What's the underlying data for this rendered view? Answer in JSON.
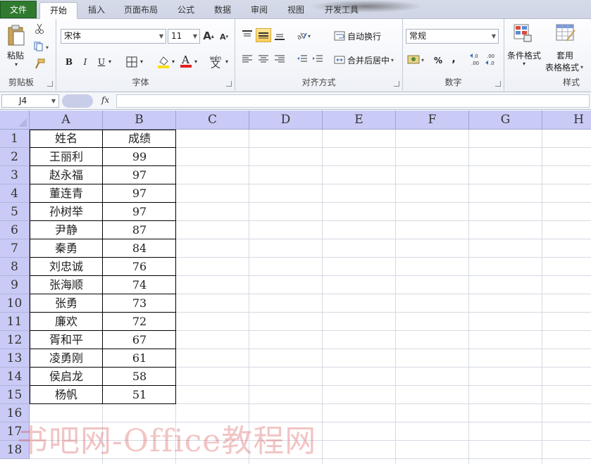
{
  "ribbon_tabs": {
    "file": "文件",
    "home": "开始",
    "insert": "插入",
    "page_layout": "页面布局",
    "formulas": "公式",
    "data": "数据",
    "review": "审阅",
    "view": "视图",
    "developer": "开发工具"
  },
  "clipboard": {
    "paste": "粘贴",
    "label": "剪贴板"
  },
  "font": {
    "name": "宋体",
    "size": "11",
    "bold": "B",
    "italic": "I",
    "underline": "U",
    "phonetic": "wén",
    "label": "字体",
    "fill_color": "#f7e01b",
    "font_color": "#e02020"
  },
  "alignment": {
    "wrap_text": "自动换行",
    "merge_center": "合并后居中",
    "label": "对齐方式"
  },
  "number": {
    "format": "常规",
    "percent": "%",
    "comma": ",",
    "inc_decimal": ".00",
    "dec_decimal": ".0",
    "label": "数字"
  },
  "styles": {
    "conditional": "条件格式",
    "table_line1": "套用",
    "table_line2": "表格格式",
    "label": "样式"
  },
  "formula_bar": {
    "name_box": "J4",
    "fx": "fx",
    "content": ""
  },
  "columns": [
    "A",
    "B",
    "C",
    "D",
    "E",
    "F",
    "G",
    "H"
  ],
  "rows": [
    "1",
    "2",
    "3",
    "4",
    "5",
    "6",
    "7",
    "8",
    "9",
    "10",
    "11",
    "12",
    "13",
    "14",
    "15",
    "16",
    "17",
    "18"
  ],
  "table": {
    "headers": [
      "姓名",
      "成绩"
    ],
    "records": [
      [
        "王丽利",
        "99"
      ],
      [
        "赵永福",
        "97"
      ],
      [
        "董连青",
        "97"
      ],
      [
        "孙树举",
        "97"
      ],
      [
        "尹静",
        "87"
      ],
      [
        "秦勇",
        "84"
      ],
      [
        "刘忠诚",
        "76"
      ],
      [
        "张海顺",
        "74"
      ],
      [
        "张勇",
        "73"
      ],
      [
        "廉欢",
        "72"
      ],
      [
        "胥和平",
        "67"
      ],
      [
        "凌勇刚",
        "61"
      ],
      [
        "侯启龙",
        "58"
      ],
      [
        "杨帆",
        "51"
      ]
    ]
  },
  "watermark": "书吧网-Office教程网"
}
